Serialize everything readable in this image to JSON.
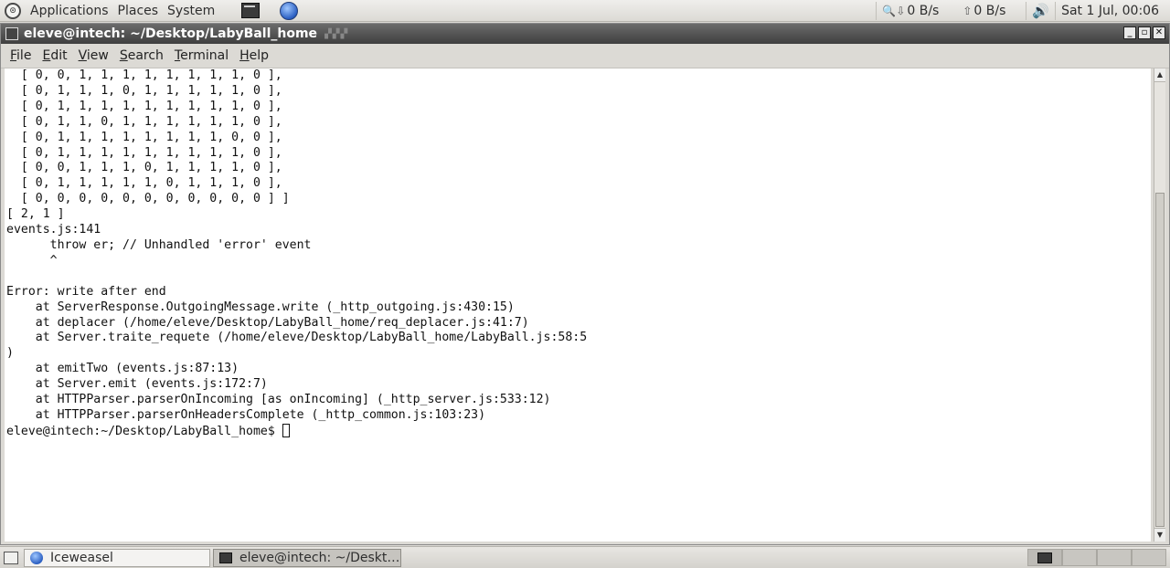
{
  "top_panel": {
    "menus": [
      "Applications",
      "Places",
      "System"
    ],
    "download_speed": "0 B/s",
    "upload_speed": "0 B/s",
    "clock": "Sat  1 Jul, 00:06"
  },
  "window": {
    "title": "eleve@intech: ~/Desktop/LabyBall_home",
    "menus": [
      {
        "key": "F",
        "rest": "ile"
      },
      {
        "key": "E",
        "rest": "dit"
      },
      {
        "key": "V",
        "rest": "iew"
      },
      {
        "key": "S",
        "rest": "earch"
      },
      {
        "key": "T",
        "rest": "erminal"
      },
      {
        "key": "H",
        "rest": "elp"
      }
    ]
  },
  "terminal": {
    "lines": [
      "  [ 0, 0, 1, 1, 1, 1, 1, 1, 1, 1, 0 ],",
      "  [ 0, 1, 1, 1, 0, 1, 1, 1, 1, 1, 0 ],",
      "  [ 0, 1, 1, 1, 1, 1, 1, 1, 1, 1, 0 ],",
      "  [ 0, 1, 1, 0, 1, 1, 1, 1, 1, 1, 0 ],",
      "  [ 0, 1, 1, 1, 1, 1, 1, 1, 1, 0, 0 ],",
      "  [ 0, 1, 1, 1, 1, 1, 1, 1, 1, 1, 0 ],",
      "  [ 0, 0, 1, 1, 1, 0, 1, 1, 1, 1, 0 ],",
      "  [ 0, 1, 1, 1, 1, 1, 0, 1, 1, 1, 0 ],",
      "  [ 0, 0, 0, 0, 0, 0, 0, 0, 0, 0, 0 ] ]",
      "[ 2, 1 ]",
      "events.js:141",
      "      throw er; // Unhandled 'error' event",
      "      ^",
      "",
      "Error: write after end",
      "    at ServerResponse.OutgoingMessage.write (_http_outgoing.js:430:15)",
      "    at deplacer (/home/eleve/Desktop/LabyBall_home/req_deplacer.js:41:7)",
      "    at Server.traite_requete (/home/eleve/Desktop/LabyBall_home/LabyBall.js:58:5",
      ")",
      "    at emitTwo (events.js:87:13)",
      "    at Server.emit (events.js:172:7)",
      "    at HTTPParser.parserOnIncoming [as onIncoming] (_http_server.js:533:12)",
      "    at HTTPParser.parserOnHeadersComplete (_http_common.js:103:23)"
    ],
    "prompt": "eleve@intech:~/Desktop/LabyBall_home$ "
  },
  "taskbar": {
    "tasks": [
      {
        "label": "Iceweasel",
        "icon": "browser-icon",
        "active": false
      },
      {
        "label": "eleve@intech: ~/Deskt…",
        "icon": "terminal-icon",
        "active": true
      }
    ]
  }
}
